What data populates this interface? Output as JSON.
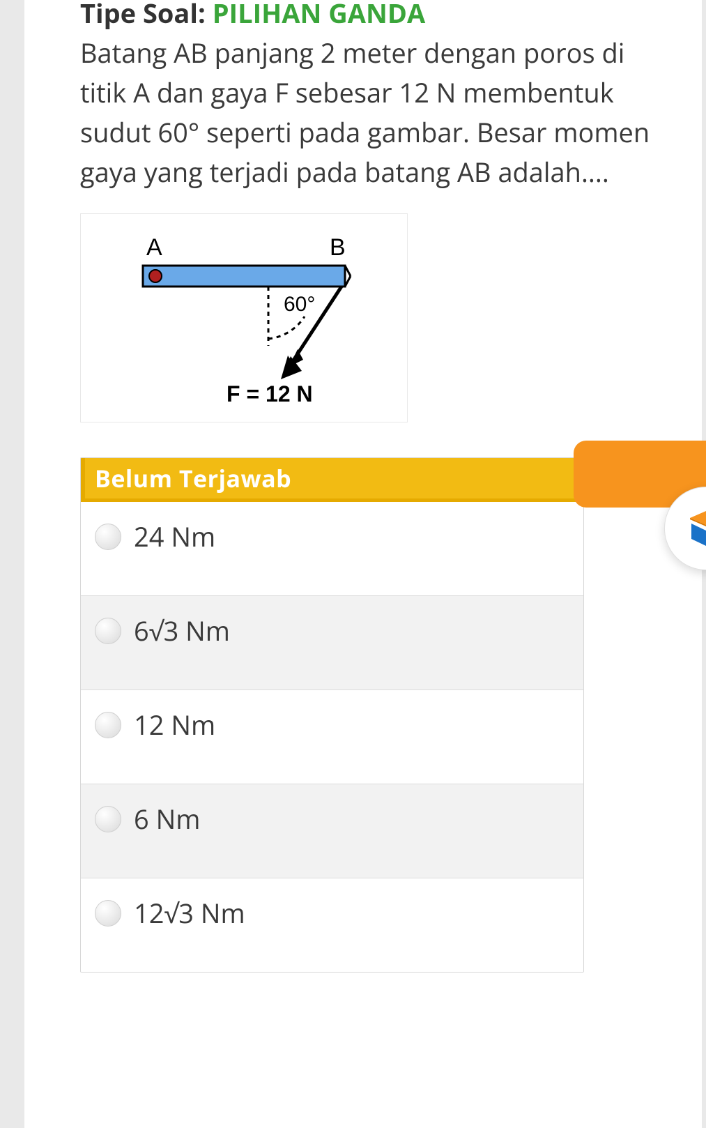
{
  "header": {
    "type_label": "Tipe Soal: ",
    "type_value": "PILIHAN GANDA"
  },
  "question": {
    "text": "Batang AB panjang 2 meter dengan poros di titik A dan gaya F sebesar 12 N membentuk sudut 60° seperti pada gambar. Besar momen gaya yang terjadi pada batang AB adalah....",
    "diagram": {
      "labelA": "A",
      "labelB": "B",
      "angle": "60°",
      "force": "F = 12 N"
    }
  },
  "answers": {
    "status": "Belum Terjawab",
    "options": [
      "24 Nm",
      "6√3 Nm",
      "12 Nm",
      "6 Nm",
      "12√3 Nm"
    ]
  },
  "fab": {
    "icon": "logo-icon"
  }
}
